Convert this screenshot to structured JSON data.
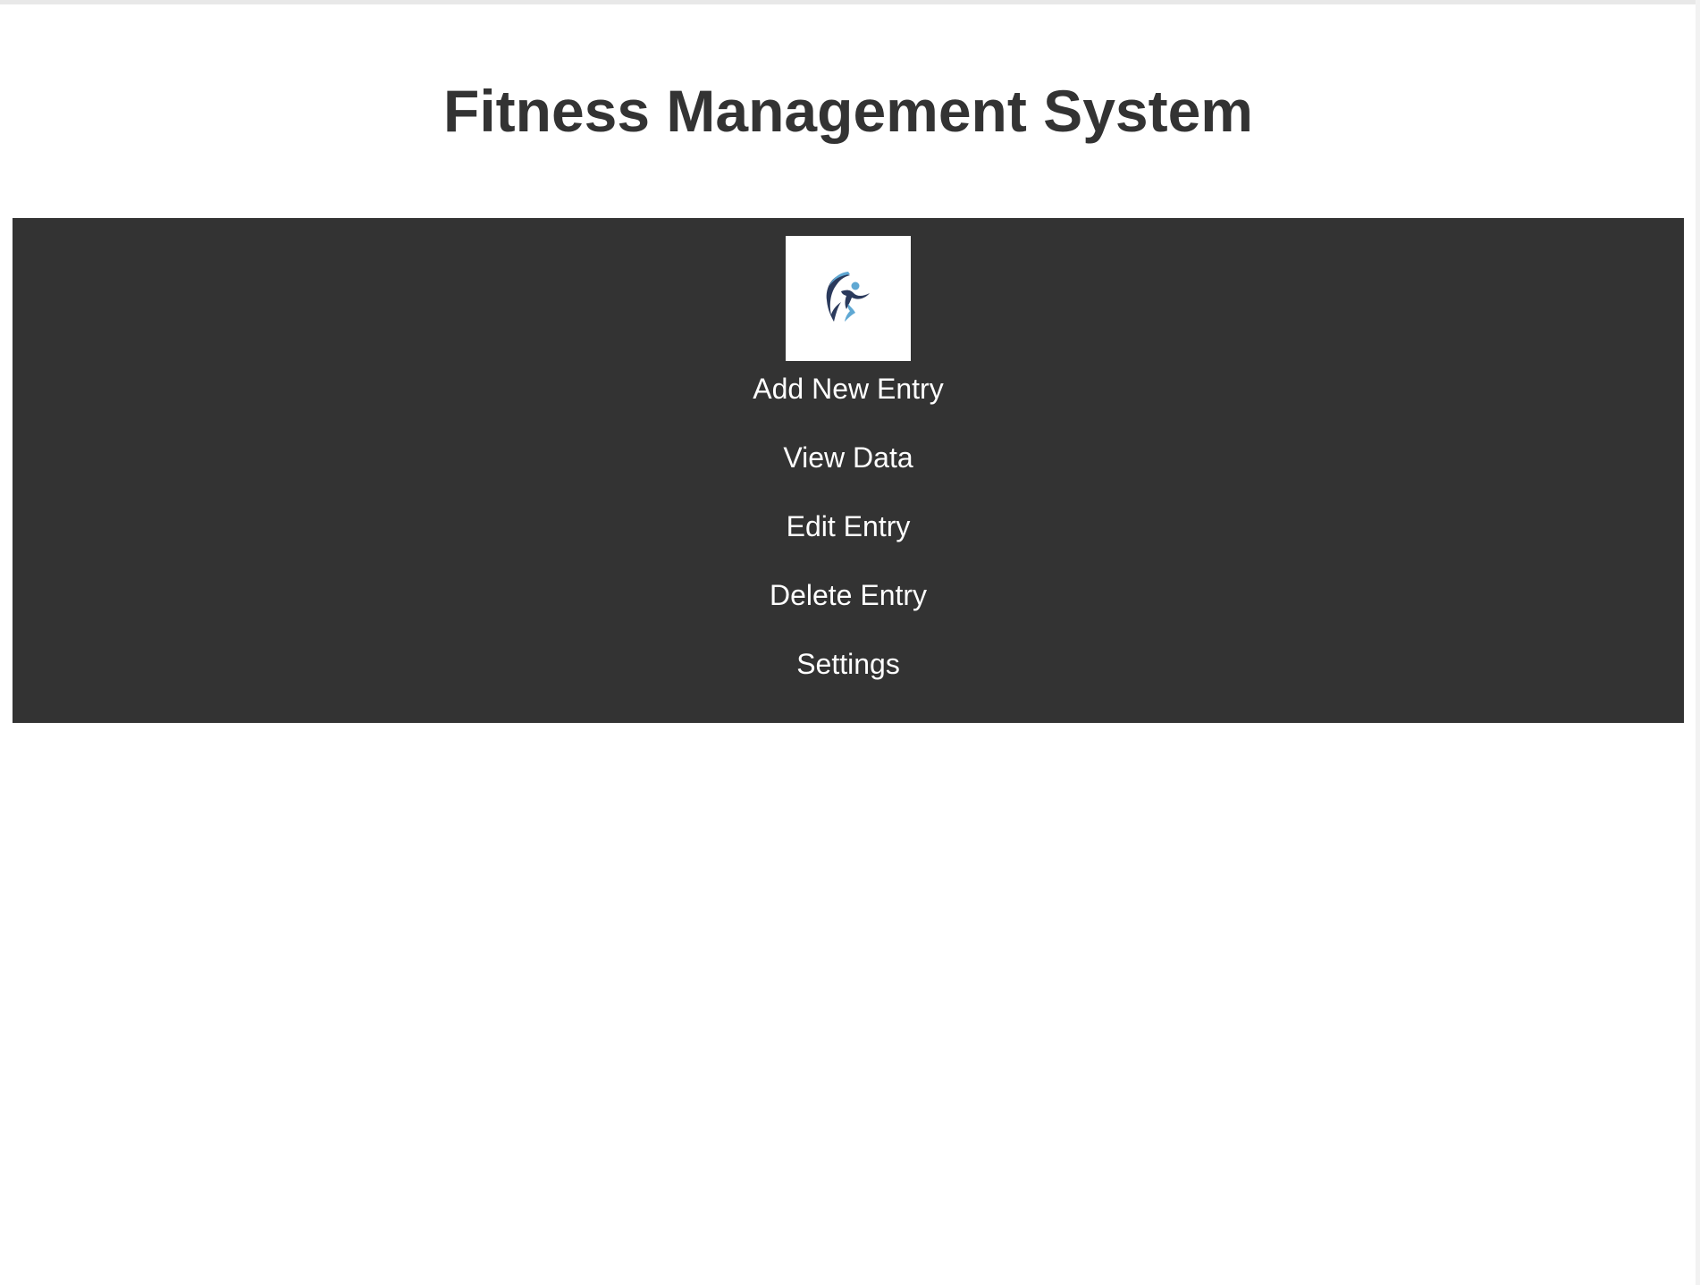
{
  "header": {
    "title": "Fitness Management System"
  },
  "nav": {
    "logo_icon": "runner-logo-icon",
    "items": [
      {
        "label": "Add New Entry"
      },
      {
        "label": "View Data"
      },
      {
        "label": "Edit Entry"
      },
      {
        "label": "Delete Entry"
      },
      {
        "label": "Settings"
      }
    ]
  },
  "colors": {
    "nav_background": "#333333",
    "title_text": "#333333",
    "nav_text": "#ffffff",
    "logo_dark": "#2b3a5c",
    "logo_light": "#5fa8d3"
  }
}
